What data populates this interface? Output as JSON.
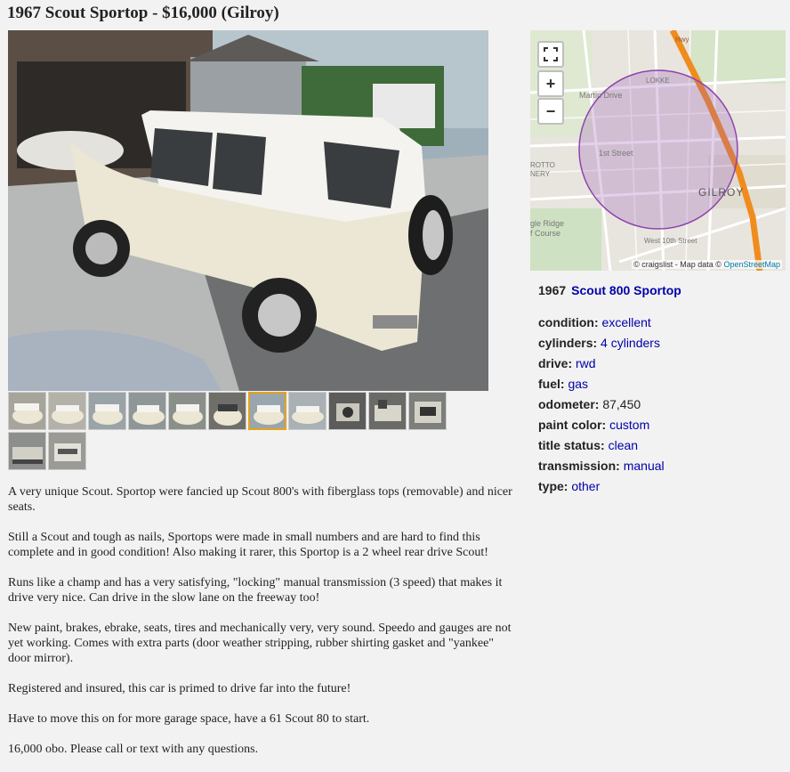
{
  "listing": {
    "title": "1967 Scout Sportop - $16,000 (Gilroy)"
  },
  "photos": {
    "count": 14,
    "selected_index": 6
  },
  "map": {
    "zoom_in_label": "+",
    "zoom_out_label": "−",
    "attribution_prefix": "© craigslist - Map data ©",
    "attribution_link": "OpenStreetMap",
    "labels": {
      "city": "GILROY",
      "street1": "Martin Drive",
      "street2": "1st Street",
      "street3": "West 10th Street",
      "area1": "LOKKE",
      "area2a": "ROTTO",
      "area2b": "NERY",
      "area3a": "gle Ridge",
      "area3b": "f Course",
      "hwy": "Hwy"
    }
  },
  "attributes": {
    "year": "1967",
    "model": "Scout 800 Sportop",
    "items": [
      {
        "label": "condition:",
        "value": "excellent",
        "link": true
      },
      {
        "label": "cylinders:",
        "value": "4 cylinders",
        "link": true
      },
      {
        "label": "drive:",
        "value": "rwd",
        "link": true
      },
      {
        "label": "fuel:",
        "value": "gas",
        "link": true
      },
      {
        "label": "odometer:",
        "value": "87,450",
        "link": false
      },
      {
        "label": "paint color:",
        "value": "custom",
        "link": true
      },
      {
        "label": "title status:",
        "value": "clean",
        "link": true
      },
      {
        "label": "transmission:",
        "value": "manual",
        "link": true
      },
      {
        "label": "type:",
        "value": "other",
        "link": true
      }
    ]
  },
  "description": [
    "A very unique Scout. Sportop were fancied up Scout 800's with fiberglass tops (removable) and nicer seats.",
    "Still a Scout and tough as nails, Sportops were made in small numbers and are hard to find this complete and in good condition! Also making it rarer, this Sportop is a 2 wheel rear drive Scout!",
    "Runs like a champ and has a very satisfying, \"locking\" manual transmission (3 speed) that makes it drive very nice. Can drive in the slow lane on the freeway too!",
    "New paint, brakes, ebrake, seats, tires and mechanically very, very sound. Speedo and gauges are not yet working. Comes with extra parts (door weather stripping, rubber shirting gasket and \"yankee\" door mirror).",
    "Registered and insured, this car is primed to drive far into the future!",
    "Have to move this on for more garage space, have a 61 Scout 80 to start.",
    "16,000 obo. Please call or text with any questions."
  ],
  "colors": {
    "link": "#0000aa",
    "selected_thumb": "#e8a21b",
    "route": "#f08c1e",
    "circle": "#8e44ad"
  }
}
